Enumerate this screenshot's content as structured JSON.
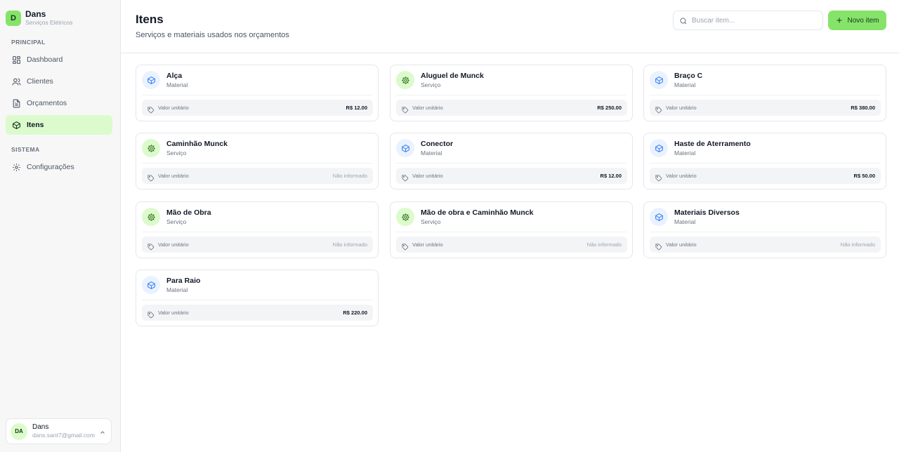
{
  "brand": {
    "initial": "D",
    "name": "Dans",
    "subtitle": "Serviços Elétricos"
  },
  "sidebar": {
    "sections": [
      {
        "label": "PRINCIPAL"
      },
      {
        "label": "SISTEMA"
      }
    ],
    "items": [
      {
        "label": "Dashboard",
        "icon": "dashboard-icon"
      },
      {
        "label": "Clientes",
        "icon": "users-icon"
      },
      {
        "label": "Orçamentos",
        "icon": "document-icon"
      },
      {
        "label": "Itens",
        "icon": "package-icon",
        "active": true
      },
      {
        "label": "Configurações",
        "icon": "gear-icon"
      }
    ]
  },
  "user": {
    "initials": "DA",
    "name": "Dans",
    "email": "dans.sant7@gmail.com"
  },
  "header": {
    "title": "Itens",
    "subtitle": "Serviços e materiais usados nos orçamentos",
    "search_placeholder": "Buscar item...",
    "new_button": "Novo item"
  },
  "colors": {
    "accent": "#86e36a",
    "accent_soft": "#dcfbcc",
    "material_icon": "#3b82f6",
    "service_icon": "#3f7a2a"
  },
  "price_label": "Valor unitário",
  "items": [
    {
      "name": "Alça",
      "type": "Material",
      "value": "R$ 12.00"
    },
    {
      "name": "Aluguel de Munck",
      "type": "Serviço",
      "value": "R$ 250.00"
    },
    {
      "name": "Braço C",
      "type": "Material",
      "value": "R$ 380.00"
    },
    {
      "name": "Caminhão Munck",
      "type": "Serviço",
      "value": "Não informado"
    },
    {
      "name": "Conector",
      "type": "Material",
      "value": "R$ 12.00"
    },
    {
      "name": "Haste de Aterramento",
      "type": "Material",
      "value": "R$ 50.00"
    },
    {
      "name": "Mão de Obra",
      "type": "Serviço",
      "value": "Não informado"
    },
    {
      "name": "Mão de obra e Caminhão Munck",
      "type": "Serviço",
      "value": "Não informado"
    },
    {
      "name": "Materiais Diversos",
      "type": "Material",
      "value": "Não informado"
    },
    {
      "name": "Para Raio",
      "type": "Material",
      "value": "R$ 220.00"
    }
  ]
}
